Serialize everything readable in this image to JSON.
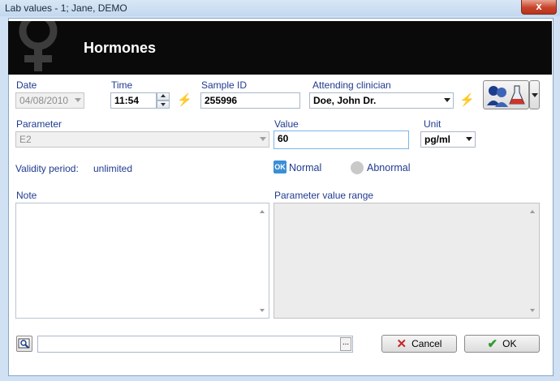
{
  "window": {
    "title": "Lab values - 1; Jane, DEMO",
    "close_label": "x"
  },
  "header": {
    "title": "Hormones",
    "icon": "female-symbol-icon"
  },
  "fields": {
    "date": {
      "label": "Date",
      "value": "04/08/2010"
    },
    "time": {
      "label": "Time",
      "value": "11:54"
    },
    "sample_id": {
      "label": "Sample ID",
      "value": "255996"
    },
    "clinician": {
      "label": "Attending clinician",
      "value": "Doe, John Dr."
    },
    "parameter": {
      "label": "Parameter",
      "value": "E2"
    },
    "value": {
      "label": "Value",
      "value": "60"
    },
    "unit": {
      "label": "Unit",
      "value": "pg/ml"
    }
  },
  "validity": {
    "label": "Validity period:",
    "value": "unlimited"
  },
  "status": {
    "ok_badge": "OK",
    "normal_label": "Normal",
    "abnormal_label": "Abnormal",
    "selected": "Normal"
  },
  "note": {
    "label": "Note"
  },
  "range": {
    "label": "Parameter value range"
  },
  "footer": {
    "ellipsis": "...",
    "cancel_label": "Cancel",
    "ok_label": "OK"
  },
  "colors": {
    "header_bg": "#0a0a0a",
    "label_blue": "#1f3b8f",
    "bolt_yellow": "#d2b100",
    "ok_badge": "#3a8fd6"
  }
}
